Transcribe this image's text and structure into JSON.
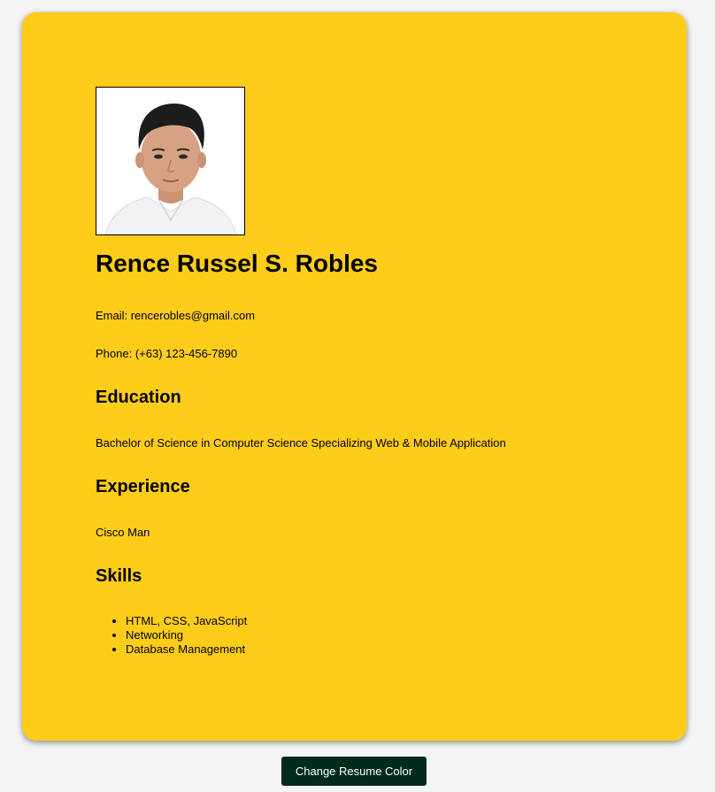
{
  "resume": {
    "name": "Rence Russel S. Robles",
    "email": "Email: rencerobles@gmail.com",
    "phone": "Phone: (+63) 123-456-7890",
    "education_heading": "Education",
    "education": "Bachelor of Science in Computer Science Specializing Web & Mobile Application",
    "experience_heading": "Experience",
    "experience": "Cisco Man",
    "skills_heading": "Skills",
    "skills": [
      "HTML, CSS, JavaScript",
      "Networking",
      "Database Management"
    ]
  },
  "button": {
    "label": "Change Resume Color"
  },
  "colors": {
    "page_background": "#f4f4f4",
    "card_background": "#fecd1a",
    "button_background": "#032a1e",
    "button_text": "#ffffff"
  }
}
